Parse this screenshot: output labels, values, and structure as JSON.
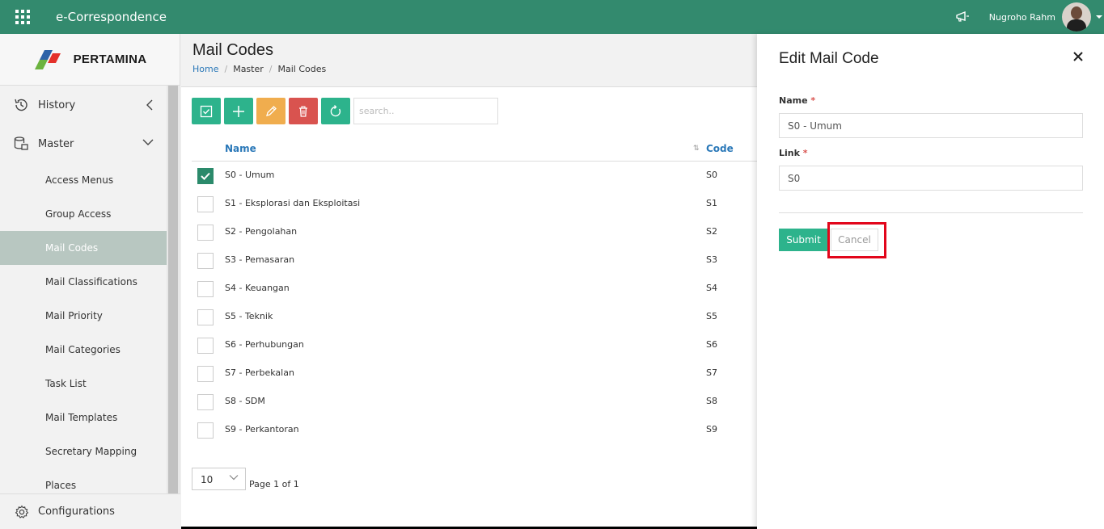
{
  "app": {
    "title": "e-Correspondence"
  },
  "user": {
    "name": "Nugroho Rahm"
  },
  "brand": {
    "logo_text": "PERTAMINA"
  },
  "colors": {
    "topbar": "#338a6e",
    "accent": "#2db38c",
    "warning": "#f0ad4e",
    "danger": "#d9534f",
    "active_nav": "#b8c7c1",
    "highlight": "#e2061b"
  },
  "sidebar": {
    "history": {
      "label": "History",
      "icon": "history-icon"
    },
    "master": {
      "label": "Master",
      "icon": "database-icon"
    },
    "items": [
      {
        "label": "Access Menus"
      },
      {
        "label": "Group Access"
      },
      {
        "label": "Mail Codes",
        "active": true
      },
      {
        "label": "Mail Classifications"
      },
      {
        "label": "Mail Priority"
      },
      {
        "label": "Mail Categories"
      },
      {
        "label": "Task List"
      },
      {
        "label": "Mail Templates"
      },
      {
        "label": "Secretary Mapping"
      },
      {
        "label": "Places"
      }
    ],
    "configurations": {
      "label": "Configurations",
      "icon": "gear-icon"
    }
  },
  "page": {
    "title": "Mail Codes",
    "breadcrumb": [
      "Home",
      "Master",
      "Mail Codes"
    ]
  },
  "toolbar": {
    "buttons": [
      "select-all-icon",
      "add-icon",
      "edit-icon",
      "delete-icon",
      "refresh-icon"
    ],
    "search_placeholder": "search.."
  },
  "table": {
    "columns": {
      "name": "Name",
      "code": "Code"
    },
    "rows": [
      {
        "name": "S0 - Umum",
        "code": "S0",
        "checked": true
      },
      {
        "name": "S1 - Eksplorasi dan Eksploitasi",
        "code": "S1",
        "checked": false
      },
      {
        "name": "S2 - Pengolahan",
        "code": "S2",
        "checked": false
      },
      {
        "name": "S3 - Pemasaran",
        "code": "S3",
        "checked": false
      },
      {
        "name": "S4 - Keuangan",
        "code": "S4",
        "checked": false
      },
      {
        "name": "S5 - Teknik",
        "code": "S5",
        "checked": false
      },
      {
        "name": "S6 - Perhubungan",
        "code": "S6",
        "checked": false
      },
      {
        "name": "S7 - Perbekalan",
        "code": "S7",
        "checked": false
      },
      {
        "name": "S8 - SDM",
        "code": "S8",
        "checked": false
      },
      {
        "name": "S9 - Perkantoran",
        "code": "S9",
        "checked": false
      }
    ]
  },
  "pager": {
    "page_size": "10",
    "info": "Page 1 of 1"
  },
  "edit_panel": {
    "title": "Edit Mail Code",
    "name_label": "Name",
    "name_value": "S0 - Umum",
    "link_label": "Link",
    "link_value": "S0",
    "required_mark": "*",
    "submit_label": "Submit",
    "cancel_label": "Cancel"
  }
}
